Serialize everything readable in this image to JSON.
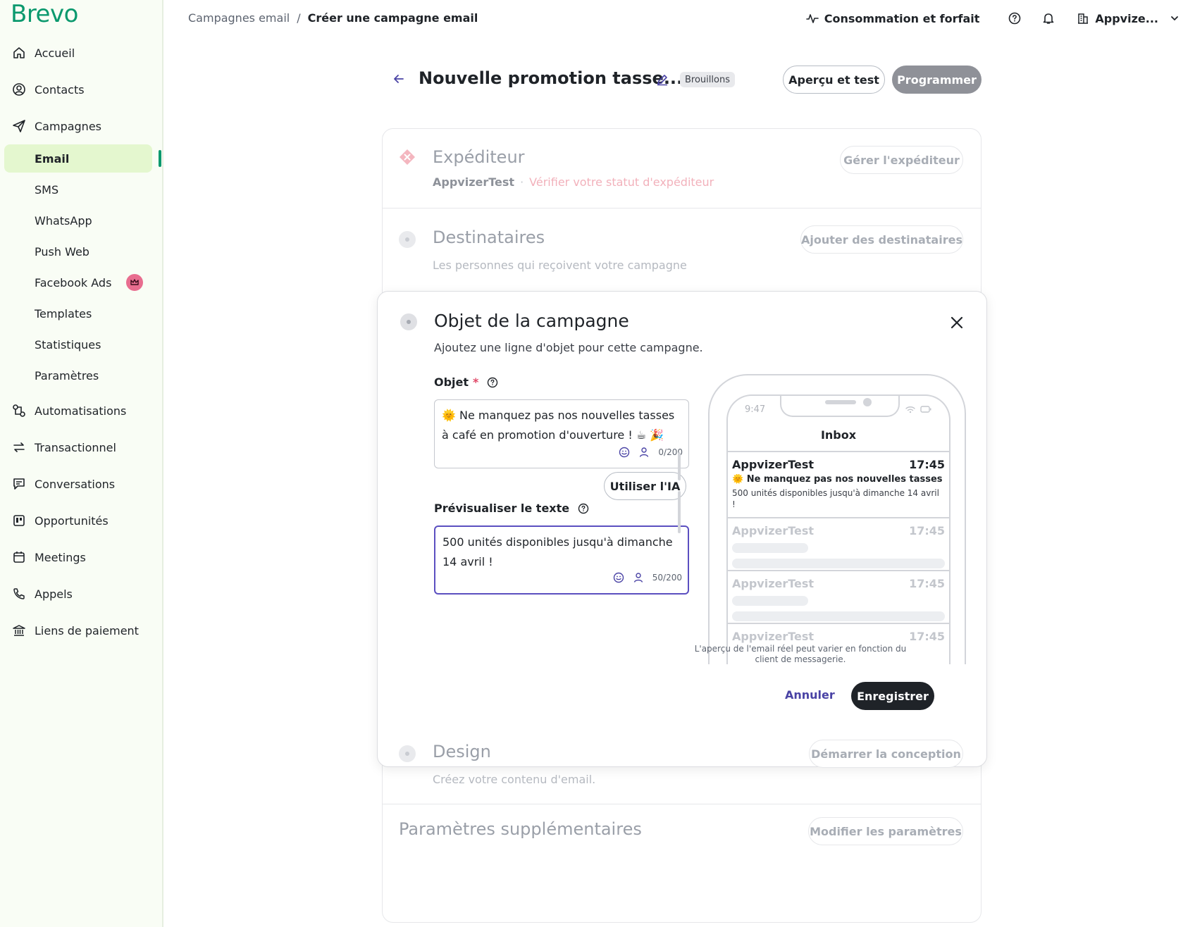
{
  "brand": {
    "name": "Brevo",
    "color": "#0b996e"
  },
  "sidebar": {
    "main_items": [
      {
        "label": "Accueil",
        "icon": "home-icon"
      },
      {
        "label": "Contacts",
        "icon": "contact-icon"
      },
      {
        "label": "Campagnes",
        "icon": "send-icon"
      }
    ],
    "campaign_sub_items": [
      {
        "label": "Email",
        "active": true
      },
      {
        "label": "SMS"
      },
      {
        "label": "WhatsApp"
      },
      {
        "label": "Push Web"
      },
      {
        "label": "Facebook Ads",
        "badge_icon": "crown-icon"
      },
      {
        "label": "Templates"
      },
      {
        "label": "Statistiques"
      },
      {
        "label": "Paramètres"
      }
    ],
    "other_items": [
      {
        "label": "Automatisations",
        "icon": "automation-icon"
      },
      {
        "label": "Transactionnel",
        "icon": "transfer-icon"
      },
      {
        "label": "Conversations",
        "icon": "chat-icon"
      },
      {
        "label": "Opportunités",
        "icon": "kanban-icon"
      },
      {
        "label": "Meetings",
        "icon": "calendar-icon"
      },
      {
        "label": "Appels",
        "icon": "phone-icon"
      },
      {
        "label": "Liens de paiement",
        "icon": "bank-icon"
      }
    ]
  },
  "breadcrumb": {
    "parent": "Campagnes email",
    "separator": "/",
    "current": "Créer une campagne email"
  },
  "topbar": {
    "usage_label": "Consommation et forfait",
    "account_label": "Appvize..."
  },
  "campaign": {
    "title": "Nouvelle promotion tasse...",
    "status_badge": "Brouillons",
    "preview_button": "Aperçu et test",
    "schedule_button": "Programmer"
  },
  "sections": {
    "sender": {
      "title": "Expéditeur",
      "name": "AppvizerTest",
      "separator": "·",
      "warning": "Vérifier votre statut d'expéditeur",
      "button": "Gérer l'expéditeur"
    },
    "recipients": {
      "title": "Destinataires",
      "subtitle": "Les personnes qui reçoivent votre campagne",
      "button": "Ajouter des destinataires"
    },
    "design": {
      "title": "Design",
      "subtitle": "Créez votre contenu d'email.",
      "button": "Démarrer la conception"
    },
    "extra": {
      "title": "Paramètres supplémentaires",
      "button": "Modifier les paramètres"
    }
  },
  "subject_panel": {
    "title": "Objet de la campagne",
    "subtitle": "Ajoutez une ligne d'objet pour cette campagne.",
    "subject_label": "Objet",
    "required_mark": "*",
    "subject_value": "🌞 Ne manquez pas nos nouvelles tasses à café en promotion d'ouverture ! ☕ 🎉",
    "subject_counter": "0/200",
    "ai_button": "Utiliser l'IA",
    "preview_label": "Prévisualiser le texte",
    "preview_value": "500 unités disponibles jusqu'à dimanche 14 avril !",
    "preview_counter": "50/200",
    "cancel": "Annuler",
    "save": "Enregistrer",
    "note": "L'aperçu de l'email réel peut varier en fonction du client de messagerie."
  },
  "phone_preview": {
    "clock": "9:47",
    "inbox_title": "Inbox",
    "first_mail": {
      "sender": "AppvizerTest",
      "time": "17:45",
      "subject": "🌞 Ne manquez pas nos nouvelles tasses",
      "preview": "500 unités disponibles jusqu'à dimanche 14 avril !"
    },
    "ghost_mails": [
      {
        "sender": "AppvizerTest",
        "time": "17:45"
      },
      {
        "sender": "AppvizerTest",
        "time": "17:45"
      },
      {
        "sender": "AppvizerTest",
        "time": "17:45"
      }
    ]
  }
}
